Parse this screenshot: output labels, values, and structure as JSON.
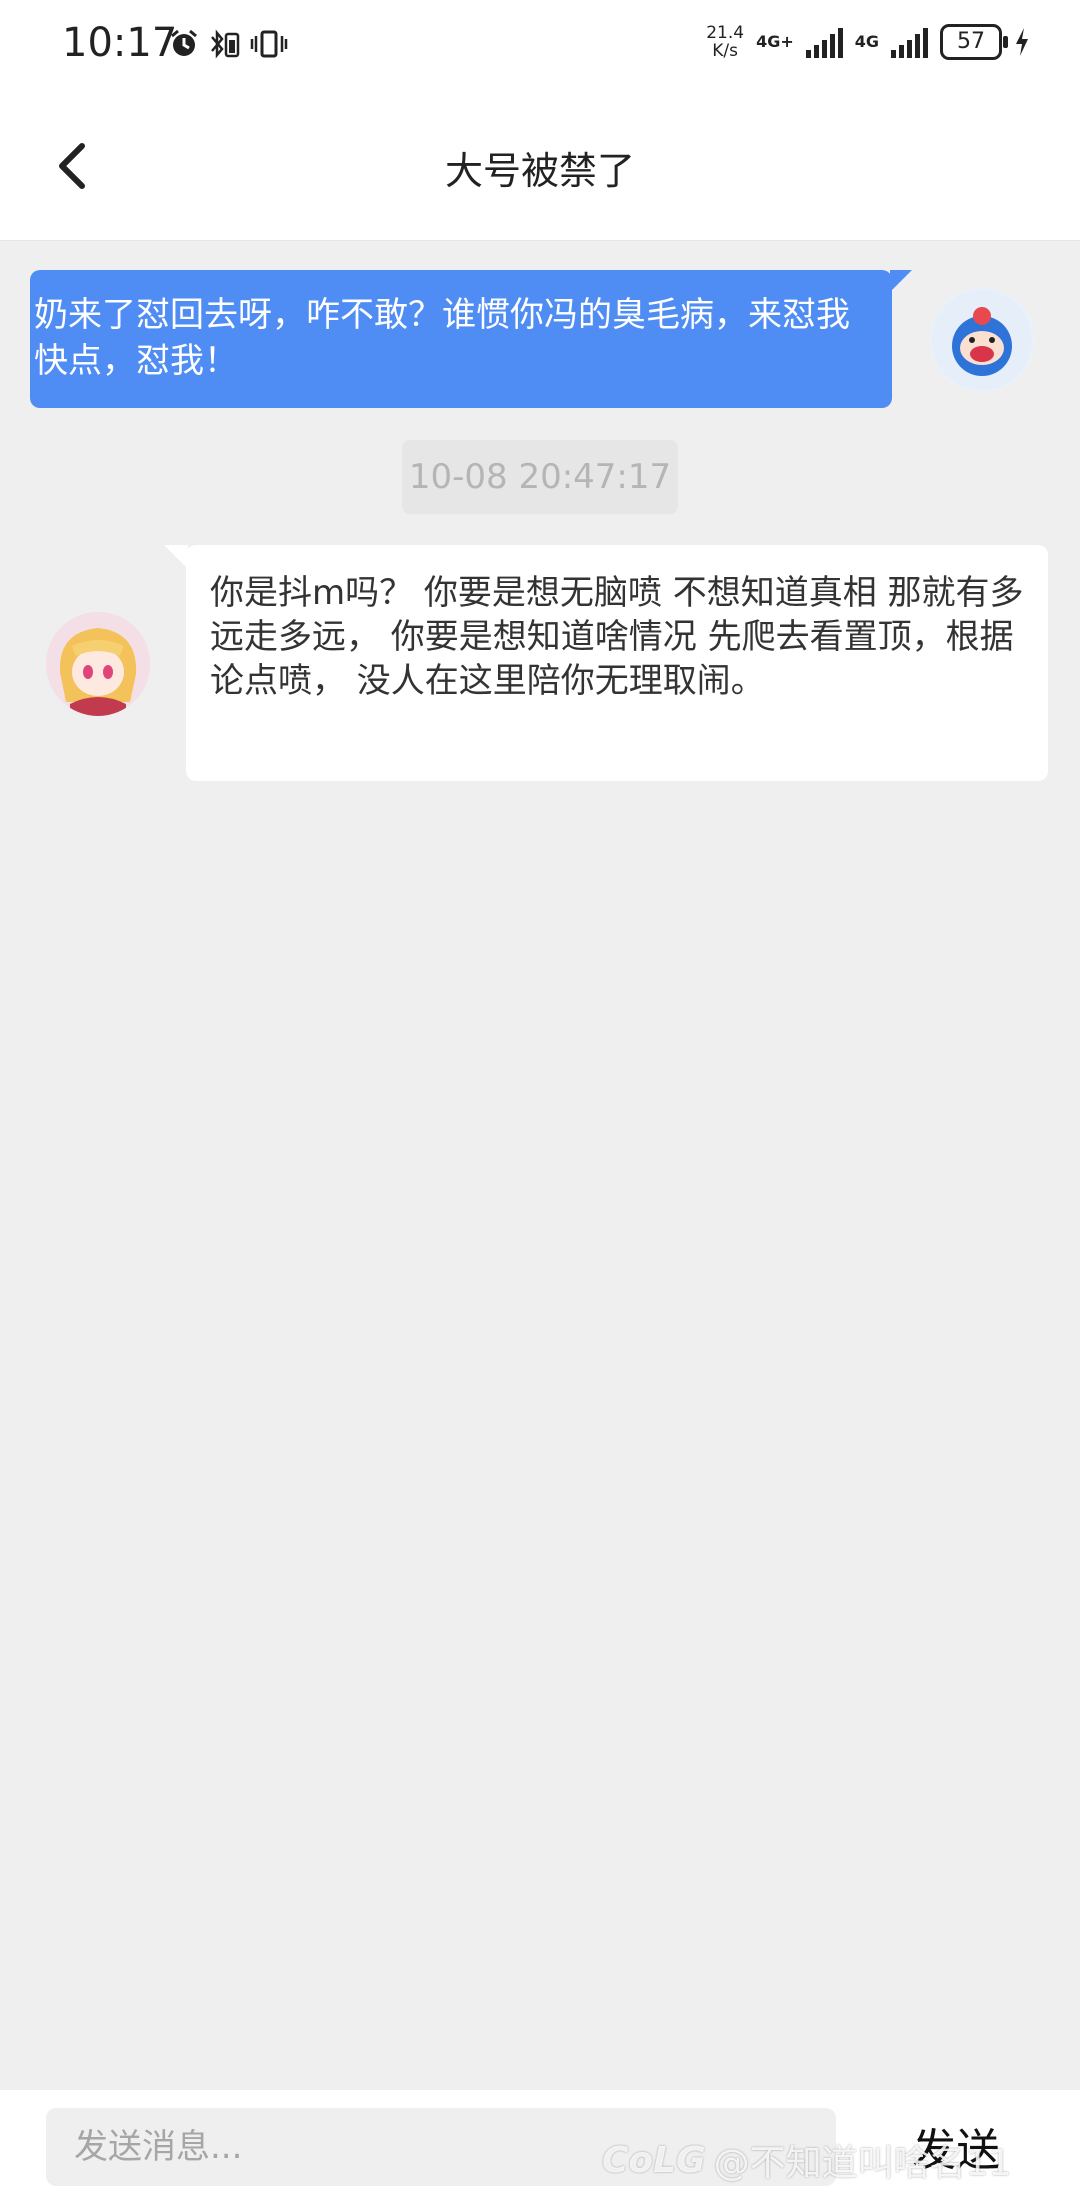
{
  "status_bar": {
    "time": "10:17",
    "speed_value": "21.4",
    "speed_unit": "K/s",
    "net1": "4G+",
    "net2": "4G",
    "battery": "57"
  },
  "header": {
    "title": "大号被禁了"
  },
  "messages": [
    {
      "direction": "sent",
      "text": "奶来了怼回去呀，咋不敢？谁惯你冯的臭毛病，来怼我快点，怼我！"
    },
    {
      "direction": "received",
      "text": "你是抖m吗？  你要是想无脑喷 不想知道真相 那就有多远走多远，  你要是想知道啥情况 先爬去看置顶，根据论点喷， 没人在这里陪你无理取闹。"
    }
  ],
  "timestamp": "10-08 20:47:17",
  "input": {
    "placeholder": "发送消息..."
  },
  "send_label": "发送",
  "watermark": {
    "logo": "CoLG",
    "text": "@不知道叫啥名11"
  },
  "colors": {
    "sent_bubble": "#4f8df4",
    "background": "#efeff0"
  }
}
